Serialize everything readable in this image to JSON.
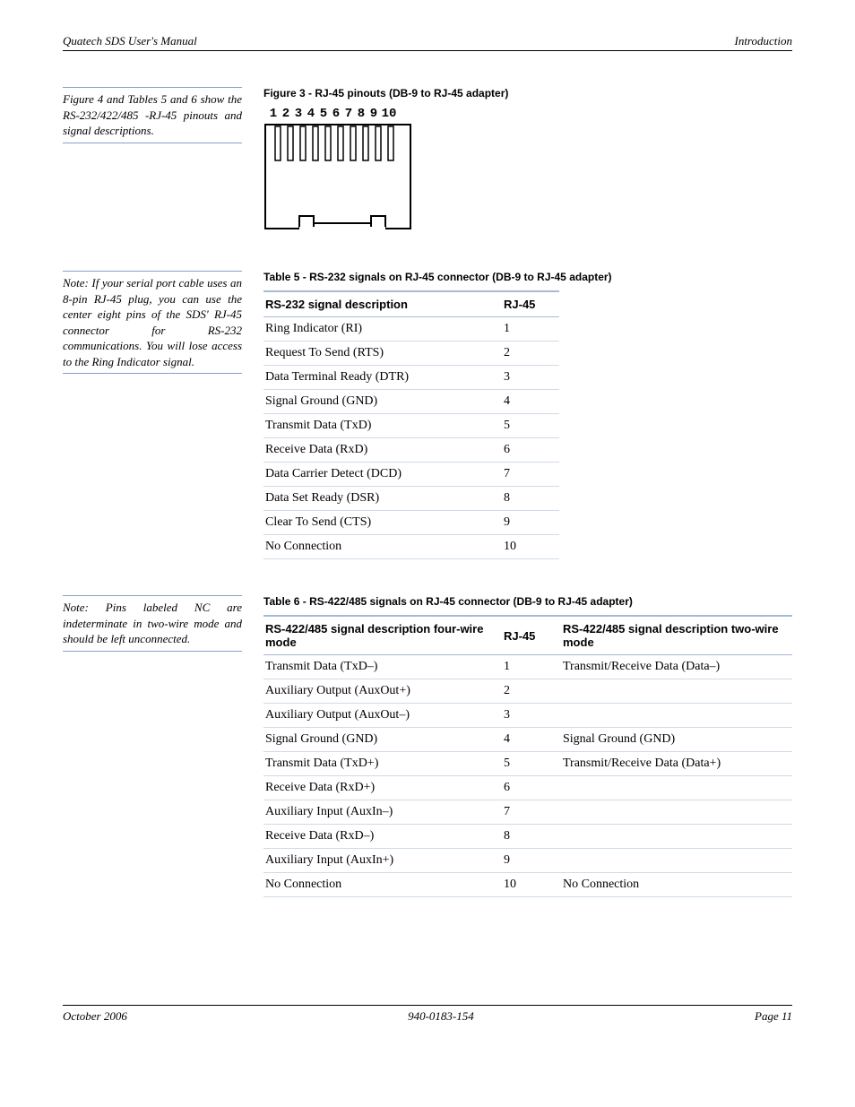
{
  "header": {
    "left": "Quatech SDS User's Manual",
    "right": "Introduction"
  },
  "figure3": {
    "caption": "Figure 3 - RJ-45 pinouts (DB-9 to RJ-45 adapter)",
    "pins": [
      "1",
      "2",
      "3",
      "4",
      "5",
      "6",
      "7",
      "8",
      "9",
      "10"
    ]
  },
  "sidenote1": "Figure 4 and Tables 5 and 6 show the RS-232/422/485 -RJ-45 pinouts and signal descriptions.",
  "sidenote2": "Note: If your serial port cable uses an 8-pin RJ-45 plug, you can use the center eight pins of the SDS' RJ-45 connector for RS-232 communications. You will lose access to the Ring Indicator signal.",
  "sidenote3": "Note: Pins labeled NC are indeterminate in two-wire mode and should be left unconnected.",
  "table5": {
    "caption": "Table 5 - RS-232 signals on RJ-45 connector (DB-9 to RJ-45 adapter)",
    "headers": [
      "RS-232 signal description",
      "RJ-45"
    ],
    "rows": [
      [
        "Ring Indicator (RI)",
        "1"
      ],
      [
        "Request To Send (RTS)",
        "2"
      ],
      [
        "Data Terminal Ready (DTR)",
        "3"
      ],
      [
        "Signal Ground (GND)",
        "4"
      ],
      [
        "Transmit Data (TxD)",
        "5"
      ],
      [
        "Receive Data (RxD)",
        "6"
      ],
      [
        "Data Carrier Detect (DCD)",
        "7"
      ],
      [
        "Data Set Ready (DSR)",
        "8"
      ],
      [
        "Clear To Send (CTS)",
        "9"
      ],
      [
        "No Connection",
        "10"
      ]
    ]
  },
  "table6": {
    "caption": "Table 6 - RS-422/485 signals on RJ-45 connector (DB-9 to RJ-45 adapter)",
    "headers": [
      "RS-422/485 signal description four-wire mode",
      "RJ-45",
      "RS-422/485 signal description two-wire mode"
    ],
    "rows": [
      [
        "Transmit Data (TxD–)",
        "1",
        "Transmit/Receive Data (Data–)"
      ],
      [
        "Auxiliary Output (AuxOut+)",
        "2",
        ""
      ],
      [
        "Auxiliary Output (AuxOut–)",
        "3",
        ""
      ],
      [
        "Signal Ground (GND)",
        "4",
        "Signal Ground (GND)"
      ],
      [
        "Transmit Data (TxD+)",
        "5",
        "Transmit/Receive Data (Data+)"
      ],
      [
        "Receive Data (RxD+)",
        "6",
        ""
      ],
      [
        "Auxiliary Input (AuxIn–)",
        "7",
        ""
      ],
      [
        "Receive Data (RxD–)",
        "8",
        ""
      ],
      [
        "Auxiliary Input (AuxIn+)",
        "9",
        ""
      ],
      [
        "No Connection",
        "10",
        "No Connection"
      ]
    ]
  },
  "footer": {
    "left": "October 2006",
    "center": "940-0183-154",
    "right": "Page 11"
  }
}
